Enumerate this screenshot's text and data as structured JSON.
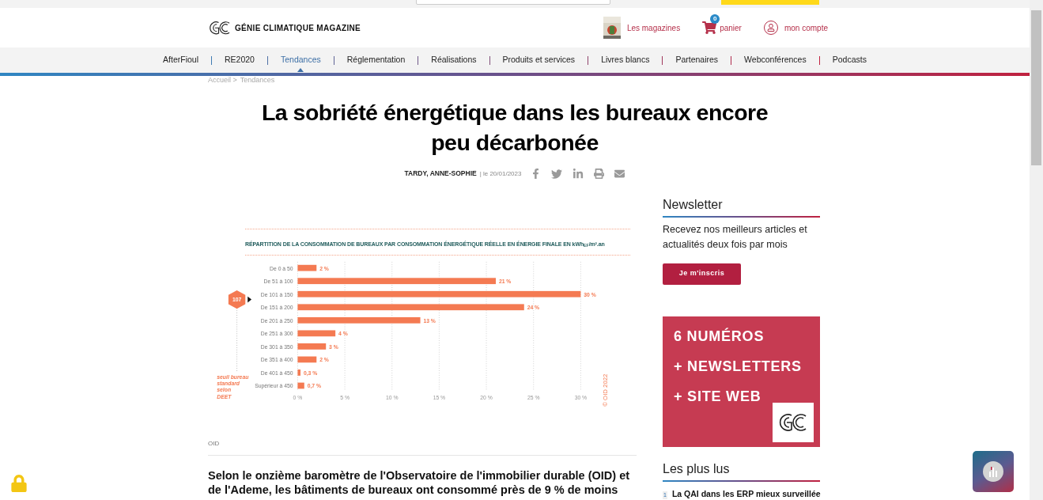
{
  "header": {
    "brand": "GÉNIE CLIMATIQUE MAGAZINE",
    "links": [
      {
        "kind": "magazines",
        "label": "Les magazines"
      },
      {
        "kind": "cart",
        "label": "panier",
        "badge": "0"
      },
      {
        "kind": "account",
        "label": "mon compte"
      }
    ]
  },
  "nav": [
    {
      "label": "AfterFioul",
      "selected": false
    },
    {
      "label": "RE2020",
      "selected": false
    },
    {
      "label": "Tendances",
      "selected": true
    },
    {
      "label": "Réglementation",
      "selected": false
    },
    {
      "label": "Réalisations",
      "selected": false
    },
    {
      "label": "Produits et services",
      "selected": false
    },
    {
      "label": "Livres blancs",
      "selected": false
    },
    {
      "label": "Partenaires",
      "selected": false
    },
    {
      "label": "Webconférences",
      "selected": false
    },
    {
      "label": "Podcasts",
      "selected": false
    }
  ],
  "breadcrumb": [
    "Accueil >",
    "Tendances"
  ],
  "article": {
    "title": "La sobriété énergétique dans les bureaux encore peu décarbonée",
    "author": "TARDY, ANNE-SOPHIE",
    "date": "| le 20/01/2023",
    "figure": {
      "caption": "OID",
      "chart_data": {
        "type": "bar",
        "orientation": "horizontal",
        "title": "RÉPARTITION DE LA CONSOMMATION DE BUREAUX PAR CONSOMMATION ÉNERGÉTIQUE RÉELLE EN ÉNERGIE FINALE EN kWh$_{EF}$/m².an",
        "categories": [
          "De 0 à 50",
          "De 51 à 100",
          "De 101 à 150",
          "De 151 à 200",
          "De 201 à 250",
          "De 251 à 300",
          "De 301 à 350",
          "De 351 à 400",
          "De 401 à 450",
          "Supérieur à 450"
        ],
        "series": [
          {
            "color": "#f47a52",
            "values": [
              2,
              21,
              30,
              24,
              13,
              4,
              3,
              2,
              0.3,
              0.7
            ]
          }
        ],
        "value_labels": [
          "2 %",
          "21 %",
          "30 %",
          "24 %",
          "13 %",
          "4 %",
          "3 %",
          "2 %",
          "0,3 %",
          "0,7 %"
        ],
        "xlim": [
          0,
          30
        ],
        "grid": true,
        "xticks": [
          {
            "value": 0,
            "label": "0 %"
          },
          {
            "value": 5,
            "label": "5 %"
          },
          {
            "value": 10,
            "label": "10 %"
          },
          {
            "value": 15,
            "label": "15 %"
          },
          {
            "value": 20,
            "label": "20 %"
          },
          {
            "value": 25,
            "label": "25 %"
          },
          {
            "value": 30,
            "label": "30 %"
          }
        ],
        "annotations": [
          {
            "text": "107"
          },
          {
            "text": "seuil bureau"
          },
          {
            "text": "standard"
          },
          {
            "text": "selon"
          },
          {
            "text": "DEET"
          },
          {
            "text": "© OID 2022"
          }
        ]
      }
    },
    "lead": "Selon le onzième baromètre de l'Observatoire de l'immobilier durable (OID) et de l'Ademe, les bâtiments de bureaux ont consommé près de 9 % de moins"
  },
  "sidebar": {
    "newsletter": {
      "heading": "Newsletter",
      "text": "Recevez nos meilleurs articles et actualités deux fois par mois",
      "button": "Je m'inscris"
    },
    "promo": [
      "6 NUMÉROS",
      "+ NEWSLETTERS",
      "+ SITE WEB"
    ],
    "most_read": {
      "heading": "Les plus lus",
      "items": [
        {
          "rank": "1",
          "title": "La QAI dans les ERP mieux surveillée"
        }
      ]
    }
  }
}
